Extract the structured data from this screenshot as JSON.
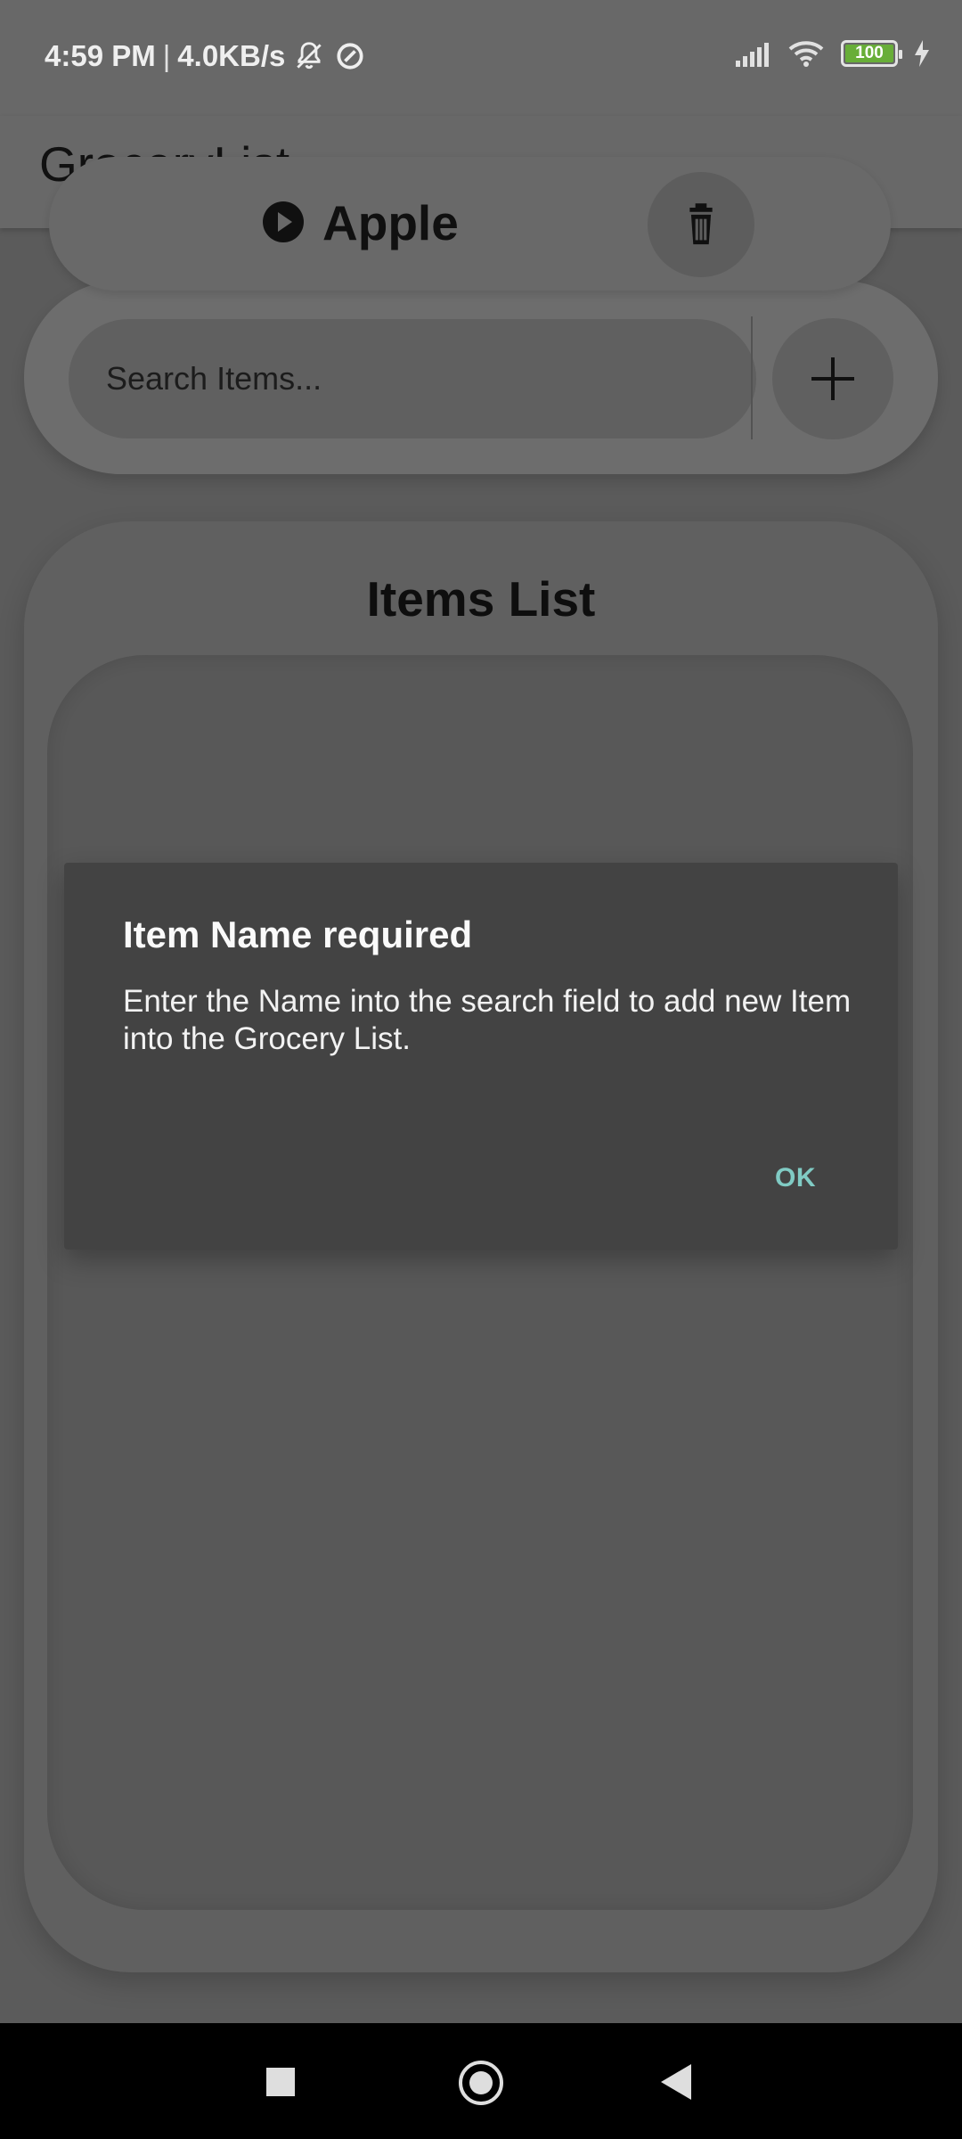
{
  "status_bar": {
    "time": "4:59 PM",
    "separator": "|",
    "network_speed": "4.0KB/s",
    "battery_level": "100",
    "icons": [
      "mute-notification-icon",
      "data-saver-icon",
      "signal-icon",
      "wifi-icon",
      "battery-icon",
      "charging-icon"
    ]
  },
  "app_bar": {
    "title": "GroceryList"
  },
  "search": {
    "placeholder": "Search Items...",
    "add_button_icon": "plus-icon"
  },
  "items_list": {
    "title": "Items List",
    "items": [
      {
        "name": "Apple",
        "leading_icon": "play-icon",
        "action_icon": "trash-icon"
      }
    ]
  },
  "dialog": {
    "title": "Item Name required",
    "message": "Enter the Name into the search field to add new Item into the Grocery List.",
    "ok_label": "OK"
  },
  "colors": {
    "dialog_ok": "#80cbc4",
    "battery_fill": "#6bb23a"
  },
  "navigation": {
    "icons": [
      "recents-icon",
      "home-icon",
      "back-icon"
    ]
  }
}
